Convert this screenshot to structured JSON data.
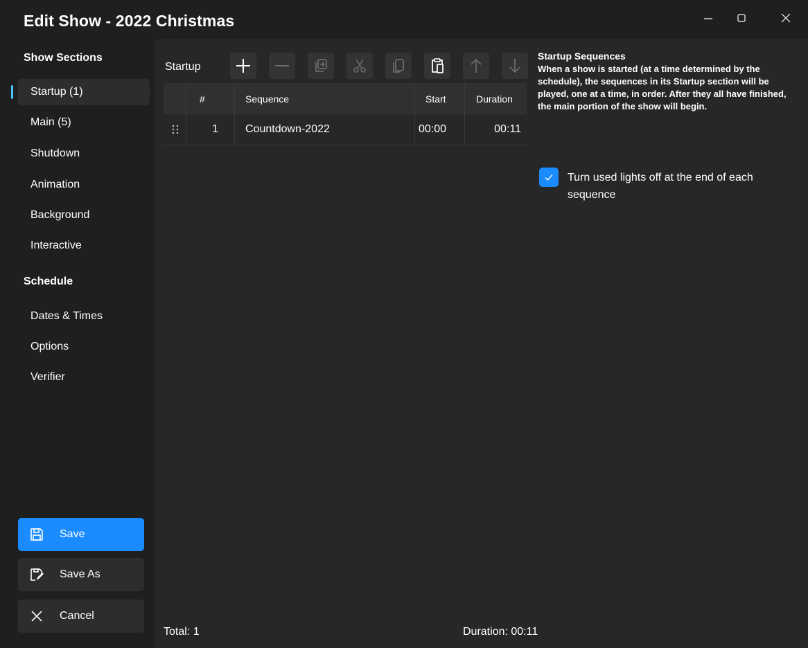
{
  "window": {
    "title": "Edit Show - 2022 Christmas"
  },
  "sidebar": {
    "sections_header": "Show Sections",
    "sections": [
      {
        "label": "Startup (1)",
        "selected": true
      },
      {
        "label": "Main (5)"
      },
      {
        "label": "Shutdown"
      },
      {
        "label": "Animation"
      },
      {
        "label": "Background"
      },
      {
        "label": "Interactive"
      }
    ],
    "schedule_header": "Schedule",
    "schedule": [
      {
        "label": "Dates & Times"
      },
      {
        "label": "Options"
      },
      {
        "label": "Verifier"
      }
    ],
    "buttons": {
      "save": "Save",
      "save_as": "Save As",
      "cancel": "Cancel"
    }
  },
  "toolbar": {
    "section_label": "Startup",
    "icons": [
      "add-icon",
      "remove-icon",
      "duplicate-icon",
      "cut-icon",
      "copy-icon",
      "paste-icon",
      "move-up-icon",
      "move-down-icon"
    ]
  },
  "table": {
    "headers": {
      "num": "#",
      "sequence": "Sequence",
      "start": "Start",
      "duration": "Duration"
    },
    "rows": [
      {
        "num": "1",
        "sequence": "Countdown-2022",
        "start": "00:00",
        "duration": "00:11"
      }
    ]
  },
  "help": {
    "title": "Startup Sequences",
    "body": "When a show is started (at a time determined by the schedule), the sequences in its Startup section will be played, one at a time, in order.  After they all have finished, the main portion of the show will begin."
  },
  "option": {
    "checked": true,
    "label": "Turn used lights off at the end of each sequence"
  },
  "footer": {
    "total": "Total: 1",
    "duration": "Duration: 00:11"
  },
  "colors": {
    "accent": "#1a8cff",
    "selection_indicator": "#4cc2ff",
    "window_bg": "#1f1f1f",
    "content_bg": "#272727"
  }
}
